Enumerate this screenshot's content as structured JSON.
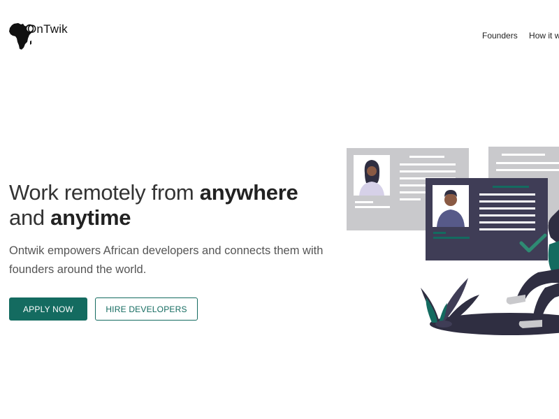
{
  "header": {
    "logo_text": "OnTwik",
    "nav": [
      {
        "label": "Founders"
      },
      {
        "label": "How it wo"
      }
    ]
  },
  "hero": {
    "headline_part1": "Work remotely from ",
    "headline_bold1": "anywhere",
    "headline_part2": "and ",
    "headline_bold2": "anytime",
    "subtitle": "Ontwik empowers African developers and connects them with founders around the world.",
    "apply_label": "APPLY NOW",
    "hire_label": "HIRE DEVELOPERS"
  },
  "colors": {
    "brand": "#146b60",
    "text": "#333333",
    "muted": "#555555",
    "card_gray": "#c9c9cc",
    "card_dark": "#3f3d56",
    "check_green": "#2e8b73"
  },
  "icons": [
    "africa-map-icon",
    "checkmark-icon"
  ]
}
